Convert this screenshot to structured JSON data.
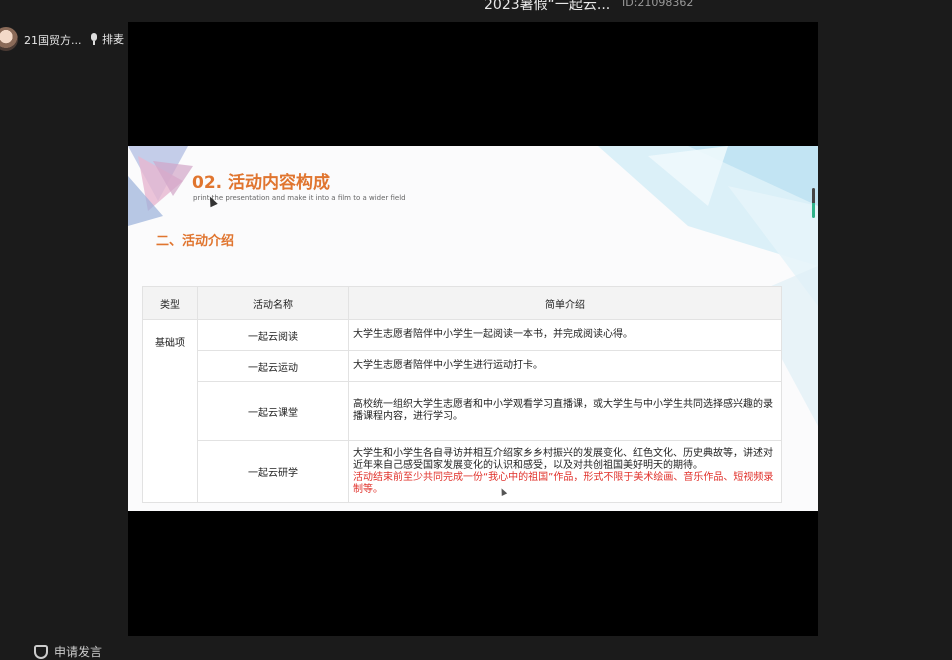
{
  "top_bar": {
    "title": "2023暑假“一起云...",
    "id": "ID:21098362"
  },
  "participants": [
    {
      "name": "21国贸方..."
    }
  ],
  "mic_button": {
    "label": "排麦"
  },
  "slide": {
    "heading": "02. 活动内容构成",
    "subheading": "print the presentation and make it into a film to a wider field",
    "section_title": "二、活动介绍",
    "table": {
      "headers": [
        "类型",
        "活动名称",
        "简单介绍"
      ],
      "type_label": "基础项",
      "rows": [
        {
          "name": "一起云阅读",
          "desc": "大学生志愿者陪伴中小学生一起阅读一本书，并完成阅读心得。",
          "note": ""
        },
        {
          "name": "一起云运动",
          "desc": "大学生志愿者陪伴中小学生进行运动打卡。",
          "note": ""
        },
        {
          "name": "一起云课堂",
          "desc": "高校统一组织大学生志愿者和中小学观看学习直播课，或大学生与中小学生共同选择感兴趣的录播课程内容，进行学习。",
          "note": ""
        },
        {
          "name": "一起云研学",
          "desc": "大学生和小学生各自寻访并相互介绍家乡乡村振兴的发展变化、红色文化、历史典故等，讲述对近年来自己感受国家发展变化的认识和感受，以及对共创祖国美好明天的期待。",
          "note": "活动结束前至少共同完成一份“我心中的祖国”作品，形式不限于美术绘画、音乐作品、短视频录制等。"
        }
      ]
    }
  },
  "bottom_bar": {
    "apply_label": "申请发言"
  },
  "colors": {
    "accent": "#e0752f",
    "note_red": "#e0302a",
    "video_bg": "#000000",
    "page_bg": "#1b1b1b"
  }
}
